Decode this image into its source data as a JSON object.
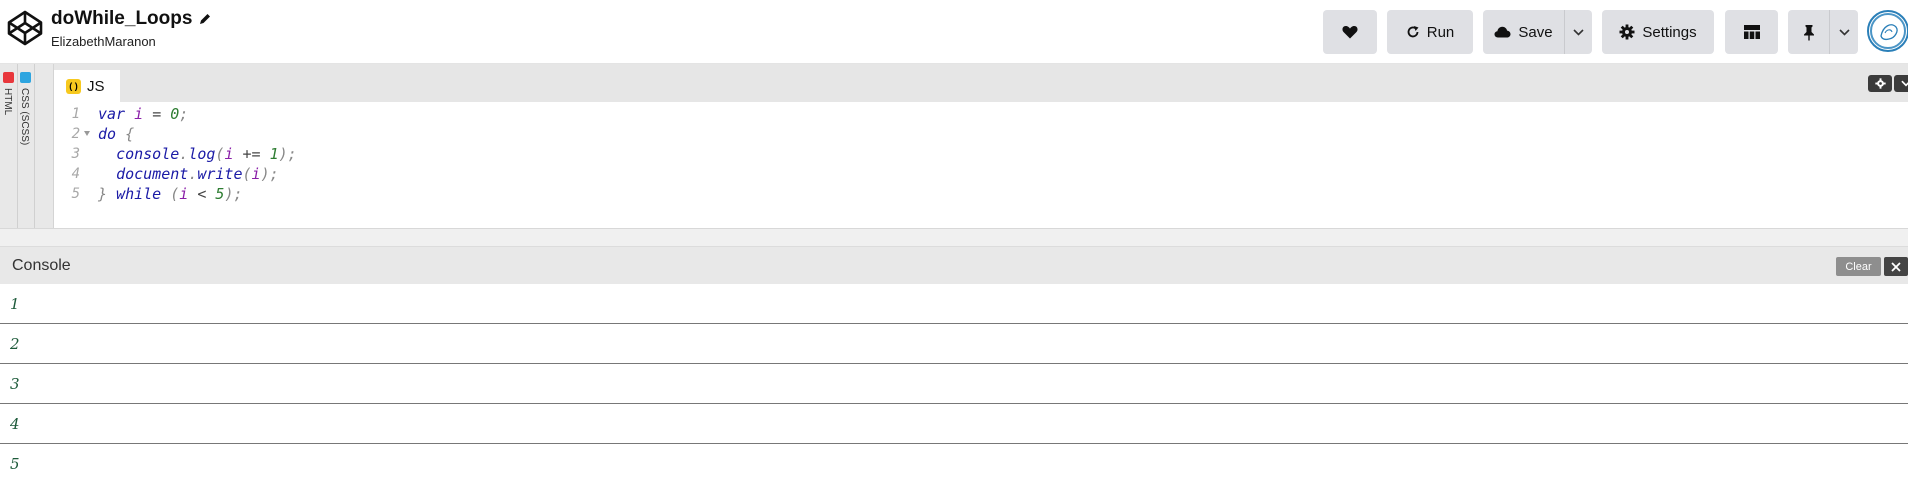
{
  "header": {
    "pen_title": "doWhile_Loops",
    "author": "ElizabethMaranon",
    "buttons": {
      "like_icon": "heart-icon",
      "run_label": "Run",
      "save_label": "Save",
      "settings_label": "Settings"
    }
  },
  "editor": {
    "side_tabs": [
      {
        "label": "HTML",
        "color": "#e8373c"
      },
      {
        "label": "CSS (SCSS)",
        "color": "#2ea5e0"
      }
    ],
    "active_tab": {
      "label": "JS",
      "badge": "( )"
    },
    "code_lines": [
      {
        "n": "1",
        "fold": false
      },
      {
        "n": "2",
        "fold": true
      },
      {
        "n": "3",
        "fold": false
      },
      {
        "n": "4",
        "fold": false
      },
      {
        "n": "5",
        "fold": false
      }
    ],
    "tokens": {
      "l1": [
        "var",
        "i",
        "=",
        "0",
        ";"
      ],
      "l2": [
        "do",
        "{"
      ],
      "l3": [
        "console",
        ".",
        "log",
        "(",
        "i",
        "+=",
        "1",
        ");"
      ],
      "l4": [
        "document",
        ".",
        "write",
        "(",
        "i",
        ");"
      ],
      "l5": [
        "}",
        "while",
        "(",
        "i",
        "<",
        "5",
        ");"
      ]
    }
  },
  "console": {
    "title": "Console",
    "clear_label": "Clear",
    "output": [
      "1",
      "2",
      "3",
      "4",
      "5"
    ]
  },
  "colors": {
    "button_bg": "#dfe0e4",
    "js_badge": "#f7c91f",
    "console_text": "#1d5a3a"
  }
}
